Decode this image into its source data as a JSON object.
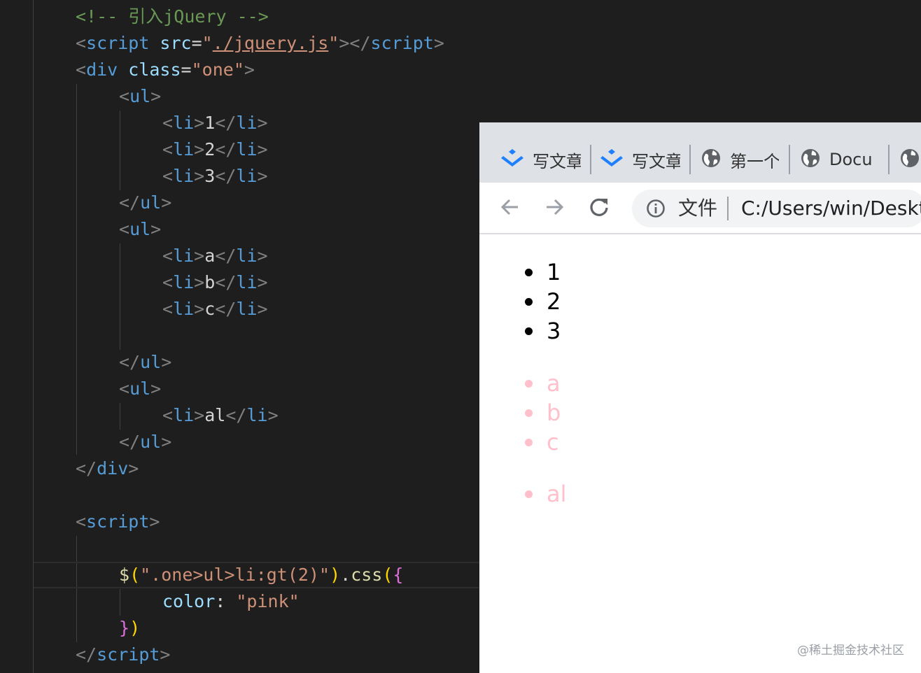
{
  "editor": {
    "comment": "<!-- 引入jQuery -->",
    "script_open": "<",
    "script_tag": "script",
    "src_attr": " src",
    "src_eq": "=",
    "q": "\"",
    "src_value": "./jquery.js",
    "gt": ">",
    "script_close": "</",
    "div_tag": "div",
    "class_attr": " class",
    "class_value": "one",
    "ul_tag": "ul",
    "li_tag": "li",
    "items_group1": [
      "1",
      "2",
      "3"
    ],
    "items_group2": [
      "a",
      "b",
      "c"
    ],
    "items_group3": [
      "al"
    ],
    "selector_dollar": "$",
    "selector_paren_open": "(",
    "selector_string": "\".one>ul>li:gt(2)\"",
    "selector_paren_close": ")",
    "css_dot": ".",
    "css_fn": "css",
    "css_open": "(",
    "brace_open": "{",
    "prop_name": "color",
    "prop_colon": ": ",
    "prop_value": "\"pink\"",
    "brace_close": "}",
    "css_close": ")"
  },
  "browser": {
    "tabs": [
      {
        "label": "写文章",
        "icon": "juejin-logo-icon"
      },
      {
        "label": "写文章",
        "icon": "juejin-logo-icon"
      },
      {
        "label": "第一个",
        "icon": "globe-icon"
      },
      {
        "label": "Docu",
        "icon": "globe-icon"
      },
      {
        "label": "",
        "icon": "globe-icon"
      }
    ],
    "omnibox": {
      "scheme_label": "文件",
      "url": "C:/Users/win/Deskt"
    },
    "list_group1": [
      "1",
      "2",
      "3"
    ],
    "list_group2": [
      "a",
      "b",
      "c"
    ],
    "list_group3": [
      "al"
    ],
    "colors": {
      "default_text": "#000000",
      "pink": "#ffc0cb",
      "tab_icon_blue": "#1e80ff"
    }
  },
  "watermark": "@稀土掘金技术社区"
}
